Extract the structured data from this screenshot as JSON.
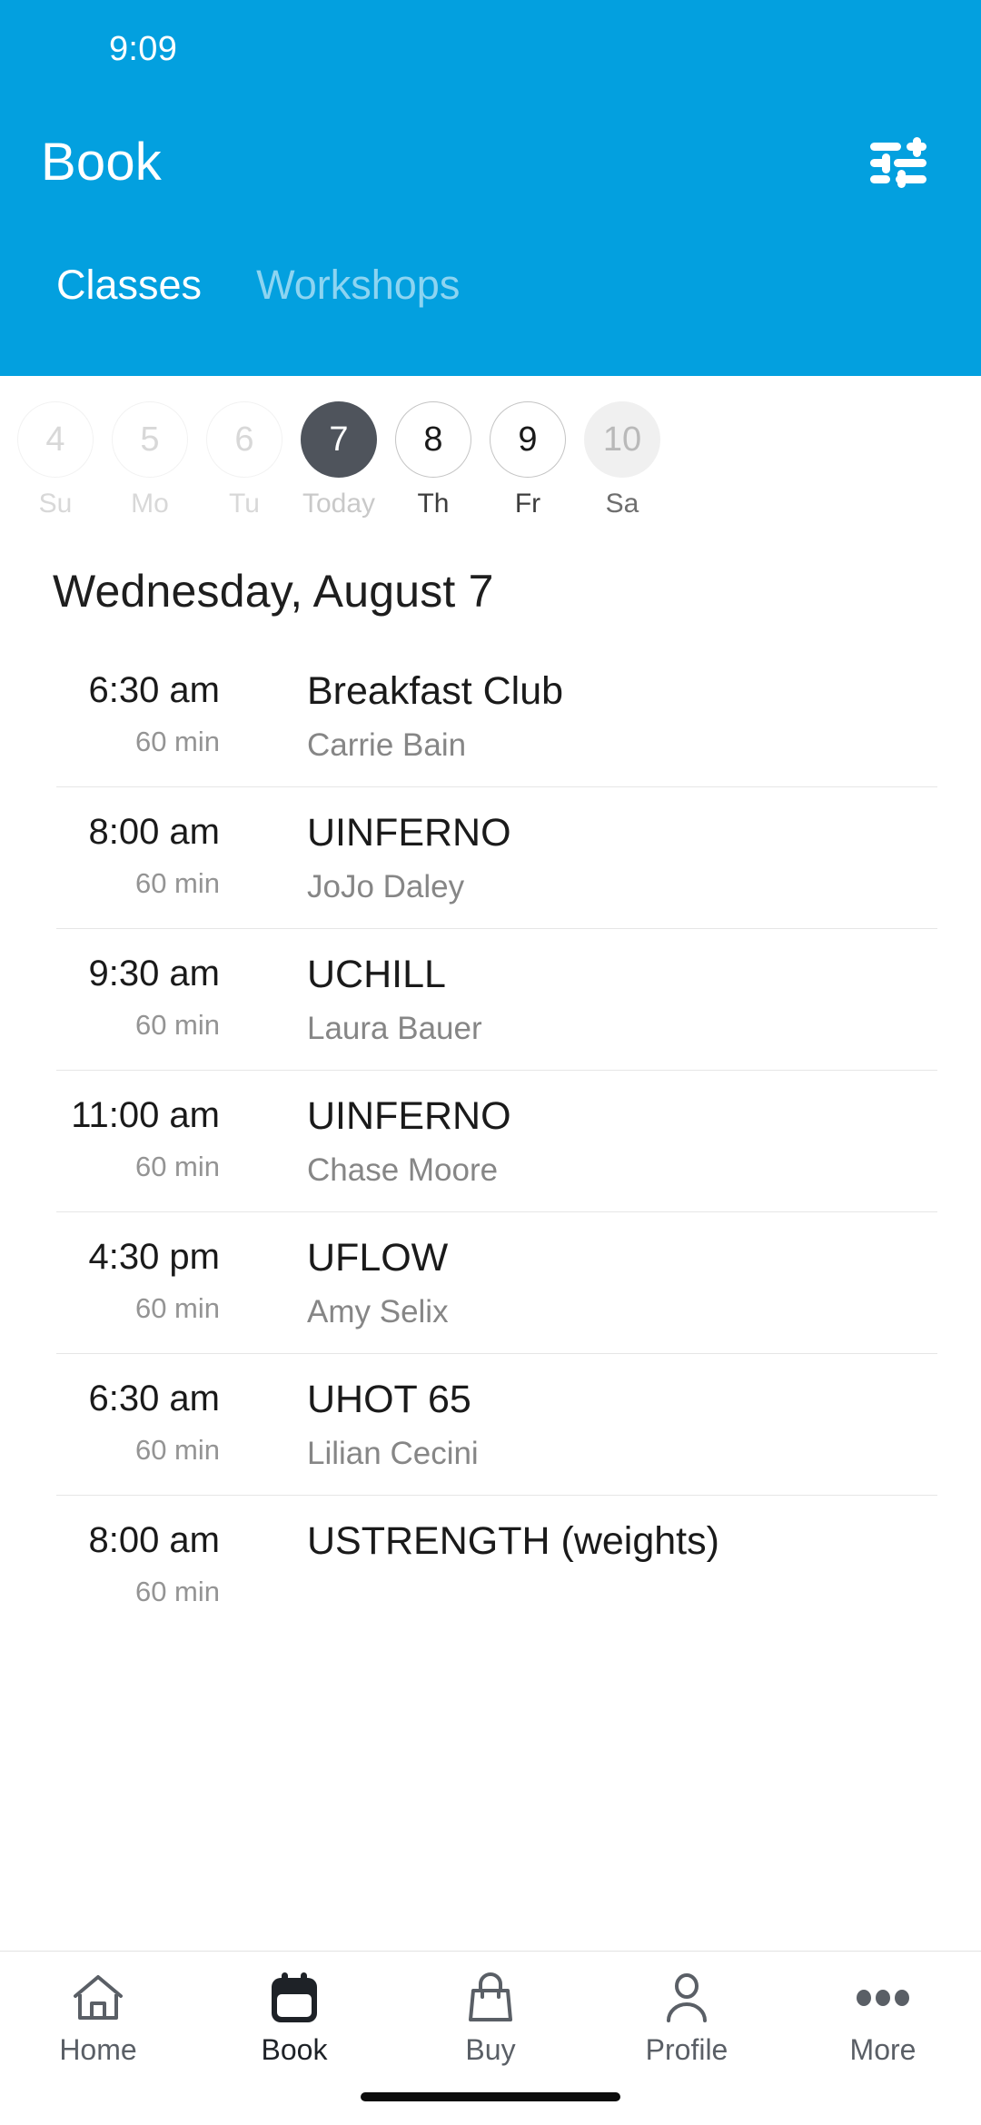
{
  "theme": {
    "accent": "#03A0DF",
    "today_circle": "#4F545C",
    "divider": "#E6E6E6",
    "muted_text": "#868686"
  },
  "status_bar": {
    "time": "9:09"
  },
  "header": {
    "title": "Book",
    "filter_icon": "tune-icon",
    "tabs": [
      {
        "label": "Classes",
        "active": true
      },
      {
        "label": "Workshops",
        "active": false
      }
    ]
  },
  "date_strip": {
    "days": [
      {
        "num": "4",
        "label": "Su",
        "state": "past"
      },
      {
        "num": "5",
        "label": "Mo",
        "state": "past"
      },
      {
        "num": "6",
        "label": "Tu",
        "state": "past"
      },
      {
        "num": "7",
        "label": "Today",
        "state": "today"
      },
      {
        "num": "8",
        "label": "Th",
        "state": "avail"
      },
      {
        "num": "9",
        "label": "Fr",
        "state": "avail"
      },
      {
        "num": "10",
        "label": "Sa",
        "state": "muted"
      }
    ]
  },
  "schedule": {
    "date_heading": "Wednesday, August 7",
    "classes": [
      {
        "time": "6:30 am",
        "duration": "60 min",
        "name": "Breakfast Club",
        "instructor": "Carrie Bain"
      },
      {
        "time": "8:00 am",
        "duration": "60 min",
        "name": "UINFERNO",
        "instructor": "JoJo Daley"
      },
      {
        "time": "9:30 am",
        "duration": "60 min",
        "name": "UCHILL",
        "instructor": "Laura Bauer"
      },
      {
        "time": "11:00 am",
        "duration": "60 min",
        "name": "UINFERNO",
        "instructor": "Chase Moore"
      },
      {
        "time": "4:30 pm",
        "duration": "60 min",
        "name": "UFLOW",
        "instructor": "Amy Selix"
      },
      {
        "time": "6:30 am",
        "duration": "60 min",
        "name": "UHOT 65",
        "instructor": "Lilian Cecini"
      },
      {
        "time": "8:00 am",
        "duration": "60 min",
        "name": "USTRENGTH (weights)",
        "instructor": ""
      }
    ]
  },
  "bottom_nav": {
    "items": [
      {
        "label": "Home",
        "icon": "home-icon",
        "active": false
      },
      {
        "label": "Book",
        "icon": "calendar-icon",
        "active": true
      },
      {
        "label": "Buy",
        "icon": "bag-icon",
        "active": false
      },
      {
        "label": "Profile",
        "icon": "person-icon",
        "active": false
      },
      {
        "label": "More",
        "icon": "ellipsis-icon",
        "active": false
      }
    ]
  }
}
